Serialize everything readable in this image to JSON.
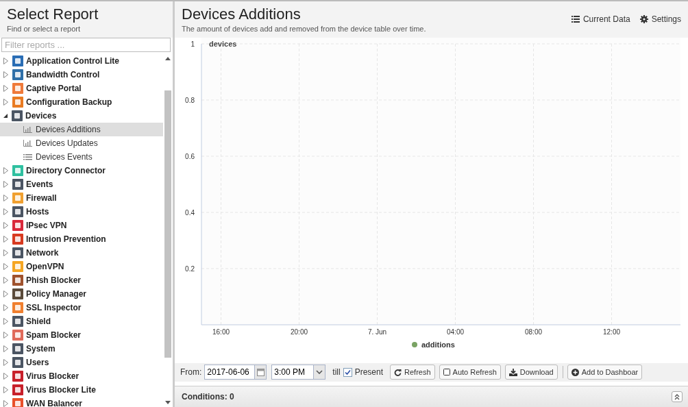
{
  "sidebar": {
    "title": "Select Report",
    "subtitle": "Find or select a report",
    "filter": {
      "placeholder": "Filter reports ..."
    },
    "items": [
      {
        "label": "Application Control Lite",
        "expanded": false,
        "color": "#2a6db5"
      },
      {
        "label": "Bandwidth Control",
        "expanded": false,
        "color": "#2f6fa8"
      },
      {
        "label": "Captive Portal",
        "expanded": false,
        "color": "#ef7a3a"
      },
      {
        "label": "Configuration Backup",
        "expanded": false,
        "color": "#e97b22"
      },
      {
        "label": "Devices",
        "expanded": true,
        "color": "#4b5563",
        "children": [
          {
            "label": "Devices Additions",
            "kind": "chart",
            "selected": true
          },
          {
            "label": "Devices Updates",
            "kind": "chart",
            "selected": false
          },
          {
            "label": "Devices Events",
            "kind": "list",
            "selected": false
          }
        ]
      },
      {
        "label": "Directory Connector",
        "expanded": false,
        "color": "#2fc0a0"
      },
      {
        "label": "Events",
        "expanded": false,
        "color": "#4b5563"
      },
      {
        "label": "Firewall",
        "expanded": false,
        "color": "#f0a030"
      },
      {
        "label": "Hosts",
        "expanded": false,
        "color": "#4b5563"
      },
      {
        "label": "IPsec VPN",
        "expanded": false,
        "color": "#d9283a"
      },
      {
        "label": "Intrusion Prevention",
        "expanded": false,
        "color": "#d83a20"
      },
      {
        "label": "Network",
        "expanded": false,
        "color": "#4b5563"
      },
      {
        "label": "OpenVPN",
        "expanded": false,
        "color": "#f5a623"
      },
      {
        "label": "Phish Blocker",
        "expanded": false,
        "color": "#a0522d"
      },
      {
        "label": "Policy Manager",
        "expanded": false,
        "color": "#5a4a3a"
      },
      {
        "label": "SSL Inspector",
        "expanded": false,
        "color": "#f08030"
      },
      {
        "label": "Shield",
        "expanded": false,
        "color": "#4b5563"
      },
      {
        "label": "Spam Blocker",
        "expanded": false,
        "color": "#e06a5a"
      },
      {
        "label": "System",
        "expanded": false,
        "color": "#4b5563"
      },
      {
        "label": "Users",
        "expanded": false,
        "color": "#4b5563"
      },
      {
        "label": "Virus Blocker",
        "expanded": false,
        "color": "#c8202a"
      },
      {
        "label": "Virus Blocker Lite",
        "expanded": false,
        "color": "#c8202a"
      },
      {
        "label": "WAN Balancer",
        "expanded": false,
        "color": "#e8502a"
      }
    ]
  },
  "report": {
    "title": "Devices Additions",
    "description": "The amount of devices add and removed from the device table over time.",
    "actions": [
      {
        "label": "Current Data",
        "kind": "list"
      },
      {
        "label": "Settings",
        "kind": "gear"
      }
    ],
    "chart_data": {
      "type": "line",
      "ylabel": "devices",
      "ylim": [
        0,
        1
      ],
      "grid": true,
      "categories": [
        "16:00",
        "20:00",
        "7. Jun",
        "04:00",
        "08:00",
        "12:00"
      ],
      "yticks": [
        0.2,
        0.4,
        0.6,
        0.8,
        1
      ],
      "series": [
        {
          "name": "additions",
          "color": "#7aa364",
          "values": [
            null,
            null,
            null,
            null,
            null,
            null
          ]
        }
      ]
    }
  },
  "toolbar": {
    "from_label": "From:",
    "date": "2017-06-06",
    "time": "3:00 PM",
    "till_label": "till",
    "present": {
      "label": "Present",
      "checked": true
    },
    "buttons": [
      {
        "label": "Refresh",
        "kind": "refresh"
      },
      {
        "label": "Auto Refresh",
        "kind": "toggle",
        "checked": false
      },
      {
        "label": "Download",
        "kind": "download"
      },
      {
        "label": "Add to Dashboar",
        "kind": "add"
      }
    ]
  },
  "conditions": {
    "label": "Conditions: 0"
  }
}
